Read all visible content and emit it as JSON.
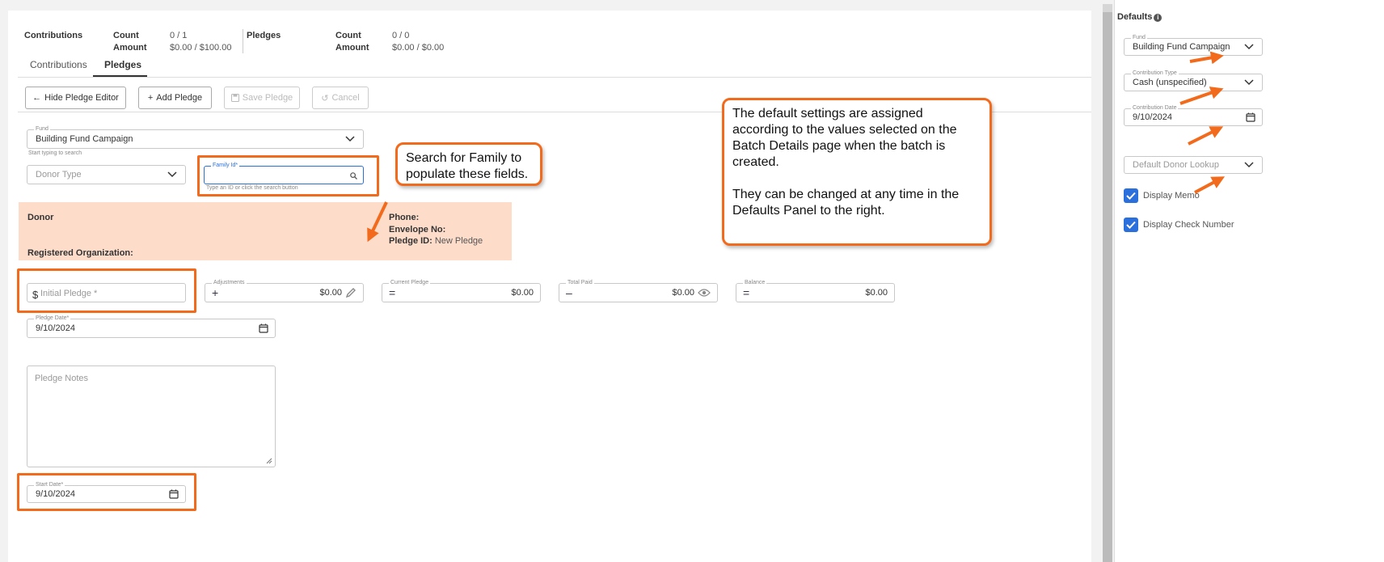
{
  "summary": {
    "contributions": {
      "title": "Contributions",
      "count_label": "Count",
      "count_value": "0 / 1",
      "amount_label": "Amount",
      "amount_value": "$0.00 / $100.00"
    },
    "pledges": {
      "title": "Pledges",
      "count_label": "Count",
      "count_value": "0 / 0",
      "amount_label": "Amount",
      "amount_value": "$0.00 / $0.00"
    }
  },
  "tabs": [
    {
      "label": "Contributions",
      "active": false
    },
    {
      "label": "Pledges",
      "active": true
    }
  ],
  "toolbar": {
    "hide_editor": "Hide Pledge Editor",
    "add_pledge": "Add Pledge",
    "save_pledge": "Save Pledge",
    "cancel": "Cancel"
  },
  "form": {
    "fund": {
      "label": "Fund",
      "value": "Building Fund Campaign",
      "hint": "Start typing to search"
    },
    "donor_type": {
      "placeholder": "Donor Type"
    },
    "family_id": {
      "label": "Family Id*",
      "hint": "Type an ID or click the search button"
    },
    "donor_info": {
      "donor_label": "Donor",
      "registered_org_label": "Registered Organization:",
      "phone_label": "Phone:",
      "envelope_label": "Envelope No:",
      "pledge_id_label": "Pledge ID:",
      "pledge_id_value": "New Pledge"
    },
    "initial_pledge": {
      "prefix": "$",
      "placeholder": "Initial Pledge *"
    },
    "adjustments": {
      "label": "Adjustments",
      "op": "+",
      "value": "$0.00"
    },
    "current_pledge": {
      "label": "Current Pledge",
      "op": "=",
      "value": "$0.00"
    },
    "total_paid": {
      "label": "Total Paid",
      "op": "–",
      "value": "$0.00"
    },
    "balance": {
      "label": "Balance",
      "op": "=",
      "value": "$0.00"
    },
    "pledge_date": {
      "label": "Pledge Date*",
      "value": "9/10/2024"
    },
    "pledge_notes": {
      "placeholder": "Pledge Notes"
    },
    "start_date": {
      "label": "Start Date*",
      "value": "9/10/2024"
    }
  },
  "callouts": {
    "search": "Search for Family to populate these fields.",
    "defaults_p1": "The default settings are assigned according to the values selected on the Batch Details page when the batch is created.",
    "defaults_p2": "They can be changed at any time in the Defaults Panel to the right."
  },
  "defaults_panel": {
    "title": "Defaults",
    "fund": {
      "label": "Fund",
      "value": "Building Fund Campaign"
    },
    "contribution_type": {
      "label": "Contribution Type",
      "value": "Cash (unspecified)"
    },
    "contribution_date": {
      "label": "Contribution Date",
      "value": "9/10/2024"
    },
    "donor_lookup": {
      "placeholder": "Default Donor Lookup"
    },
    "display_memo": "Display Memo",
    "display_check_number": "Display Check Number"
  },
  "colors": {
    "accent_orange": "#f26a1b",
    "checkbox_blue": "#2a6fdb",
    "donor_panel": "#fddcca"
  }
}
